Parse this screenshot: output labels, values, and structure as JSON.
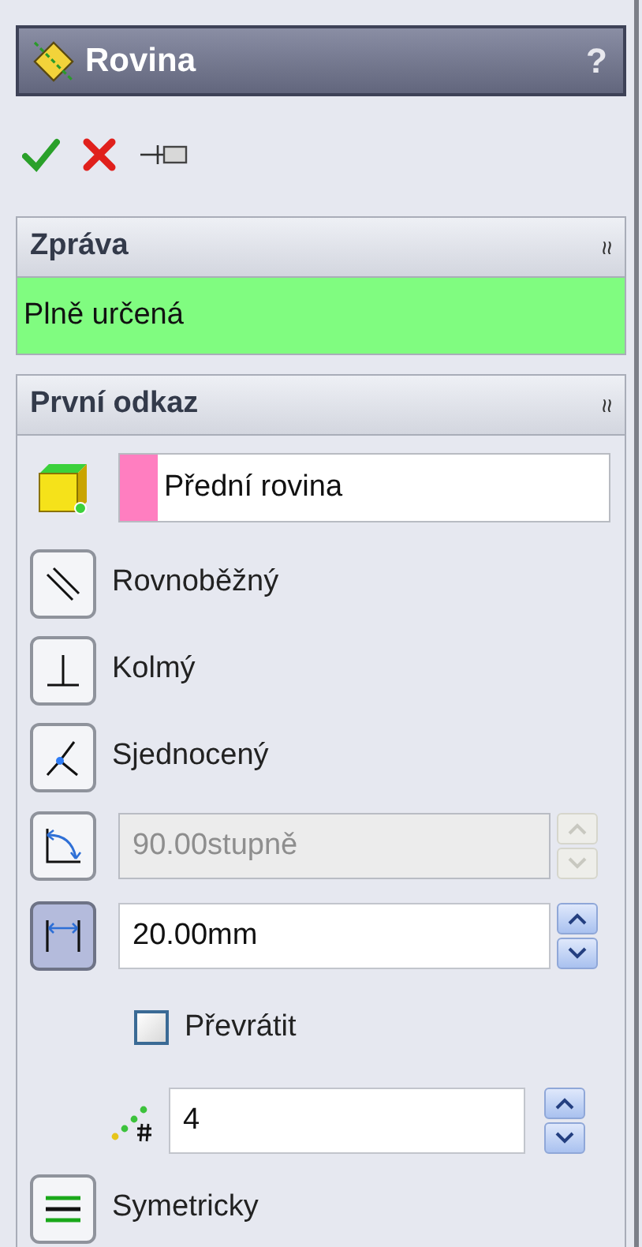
{
  "window": {
    "title": "Rovina",
    "help": "?"
  },
  "message": {
    "title": "Zpráva",
    "collapse": "≈",
    "text": "Plně určená"
  },
  "reference": {
    "title": "První odkaz",
    "collapse": "≈",
    "value": "Přední rovina"
  },
  "options": [
    {
      "kind": "mode",
      "label": "Rovnoběžný",
      "selected": false
    },
    {
      "kind": "mode",
      "label": "Kolmý",
      "selected": false
    },
    {
      "kind": "mode",
      "label": "Sjednocený",
      "selected": false
    },
    {
      "kind": "spin",
      "value": "90.00stupně",
      "selected": false,
      "disabled": true
    },
    {
      "kind": "spin",
      "value": "20.00mm",
      "selected": true,
      "disabled": false
    },
    {
      "kind": "checkbox",
      "label": "Převrátit",
      "checked": false
    },
    {
      "kind": "count",
      "value": "4"
    },
    {
      "kind": "mode",
      "label": "Symetricky",
      "selected": false
    }
  ]
}
